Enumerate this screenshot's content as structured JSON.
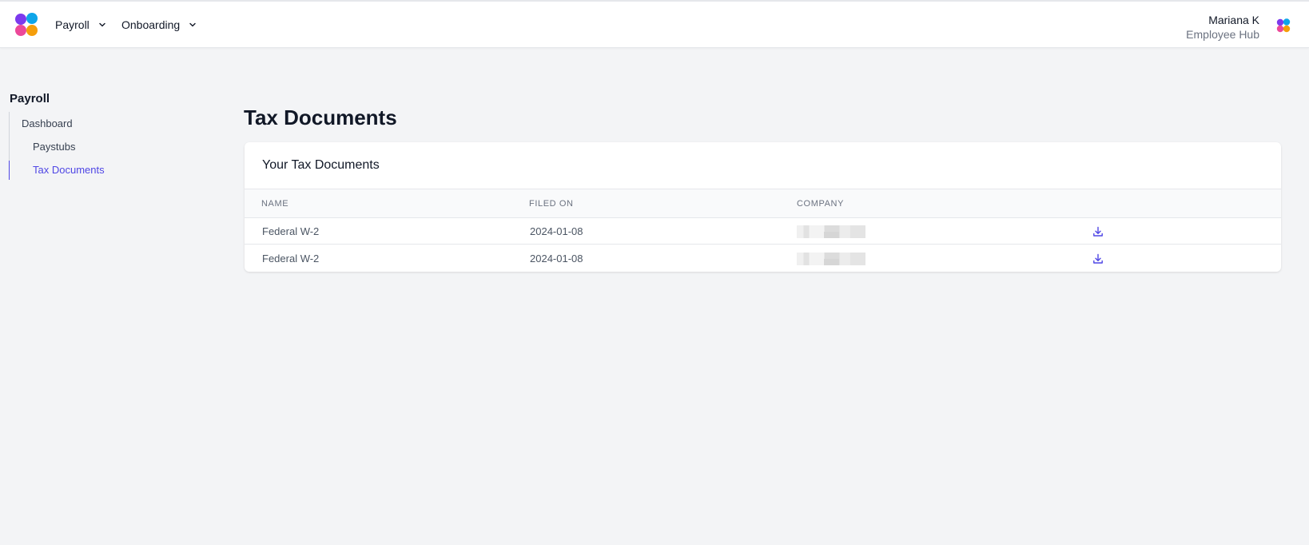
{
  "header": {
    "nav": [
      {
        "label": "Payroll"
      },
      {
        "label": "Onboarding"
      }
    ],
    "user": {
      "name": "Mariana K",
      "subtitle": "Employee Hub"
    }
  },
  "sidebar": {
    "title": "Payroll",
    "items": [
      {
        "label": "Dashboard"
      },
      {
        "label": "Paystubs"
      },
      {
        "label": "Tax Documents",
        "active": true
      }
    ]
  },
  "main": {
    "page_title": "Tax Documents",
    "card_title": "Your Tax Documents",
    "columns": [
      "NAME",
      "FILED ON",
      "COMPANY",
      ""
    ],
    "rows": [
      {
        "name": "Federal W-2",
        "filed_on": "2024-01-08",
        "company": ""
      },
      {
        "name": "Federal W-2",
        "filed_on": "2024-01-08",
        "company": ""
      }
    ]
  },
  "colors": {
    "accent": "#4f46e5",
    "background": "#f3f4f6"
  },
  "icons": {
    "logo": "brand-pinwheel-logo",
    "chevron": "chevron-down-icon",
    "download": "download-icon"
  }
}
